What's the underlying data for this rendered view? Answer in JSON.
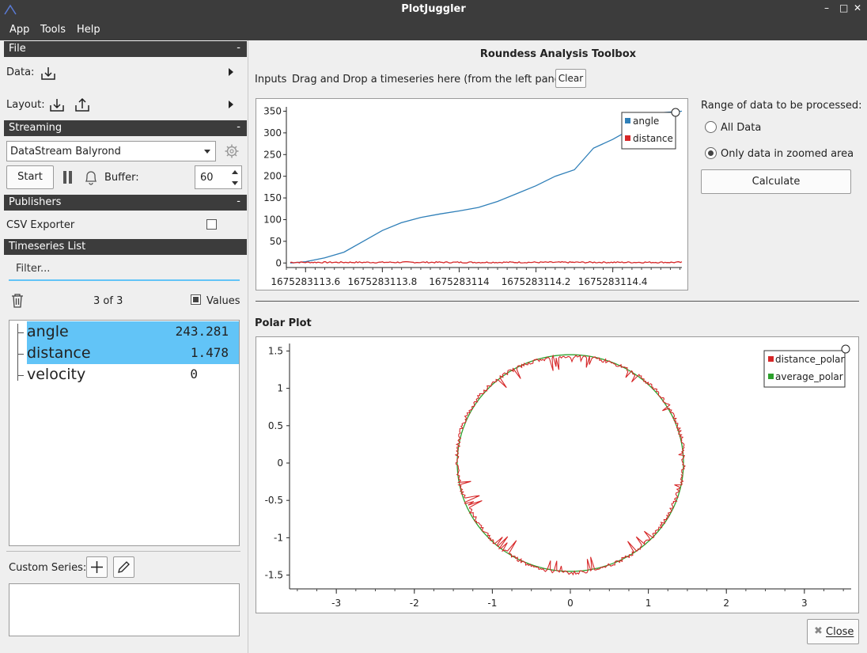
{
  "window": {
    "title": "PlotJuggler"
  },
  "menu": [
    "App",
    "Tools",
    "Help"
  ],
  "file_section": {
    "title": "File",
    "collapse": "-",
    "data_label": "Data:",
    "layout_label": "Layout:"
  },
  "streaming": {
    "title": "Streaming",
    "collapse": "-",
    "source": "DataStream Balyrond",
    "start_label": "Start",
    "buffer_label": "Buffer:",
    "buffer_value": "60"
  },
  "publishers": {
    "title": "Publishers",
    "collapse": "-",
    "csv_label": "CSV Exporter",
    "csv_checked": false
  },
  "timeseries": {
    "title": "Timeseries List",
    "filter_placeholder": "Filter...",
    "count": "3 of 3",
    "values_label": "Values",
    "items": [
      {
        "name": "angle",
        "value": "243.281",
        "selected": true
      },
      {
        "name": "distance",
        "value": "1.478",
        "selected": true
      },
      {
        "name": "velocity",
        "value": "0",
        "selected": false
      }
    ],
    "custom_label": "Custom Series:"
  },
  "toolbox": {
    "title": "Roundess Analysis Toolbox",
    "inputs_label": "Inputs",
    "drop_hint": "Drag and Drop a timeseries here (from the left panel):",
    "clear_label": "Clear",
    "range_title": "Range of data to be processed:",
    "range_options": [
      {
        "label": "All Data",
        "checked": false
      },
      {
        "label": "Only data in zoomed area",
        "checked": true
      }
    ],
    "calculate_label": "Calculate",
    "polar_title": "Polar Plot",
    "close_label": "Close"
  },
  "colors": {
    "accent": "#62c4f7",
    "angle": "#2f7fb8",
    "distance": "#d62728",
    "average": "#2ca02c"
  },
  "chart_data": [
    {
      "type": "line",
      "title": "",
      "x_tick_labels": [
        "1675283113.6",
        "1675283113.8",
        "1675283114",
        "1675283114.2",
        "1675283114.4"
      ],
      "y_tick_labels": [
        "0",
        "50",
        "100",
        "150",
        "200",
        "250",
        "300",
        "350"
      ],
      "xlim": [
        1675283113.55,
        1675283114.58
      ],
      "ylim": [
        -5,
        360
      ],
      "legend": "top-right",
      "series": [
        {
          "name": "angle",
          "x": [
            1675283113.56,
            1675283113.6,
            1675283113.65,
            1675283113.7,
            1675283113.75,
            1675283113.8,
            1675283113.85,
            1675283113.9,
            1675283113.95,
            1675283114.0,
            1675283114.05,
            1675283114.1,
            1675283114.15,
            1675283114.2,
            1675283114.25,
            1675283114.3,
            1675283114.35,
            1675283114.4,
            1675283114.45,
            1675283114.5,
            1675283114.58
          ],
          "y": [
            0,
            3,
            12,
            25,
            50,
            75,
            93,
            105,
            113,
            120,
            128,
            142,
            160,
            178,
            200,
            215,
            265,
            285,
            310,
            345,
            350
          ]
        },
        {
          "name": "distance",
          "x": [
            1675283113.56,
            1675283114.58
          ],
          "y": [
            1.5,
            1.5
          ]
        }
      ]
    },
    {
      "type": "scatter",
      "title": "Polar Plot",
      "x_tick_labels": [
        "-3",
        "-2",
        "-1",
        "0",
        "1",
        "2",
        "3"
      ],
      "y_tick_labels": [
        "-1.5",
        "-1",
        "-0.5",
        "0",
        "0.5",
        "1",
        "1.5"
      ],
      "xlim": [
        -3.6,
        3.6
      ],
      "ylim": [
        -1.6,
        1.6
      ],
      "legend": "top-right",
      "series": [
        {
          "name": "distance_polar",
          "radius_mean": 1.45,
          "spike_amplitude": 0.12
        },
        {
          "name": "average_polar",
          "radius": 1.45
        }
      ]
    }
  ]
}
